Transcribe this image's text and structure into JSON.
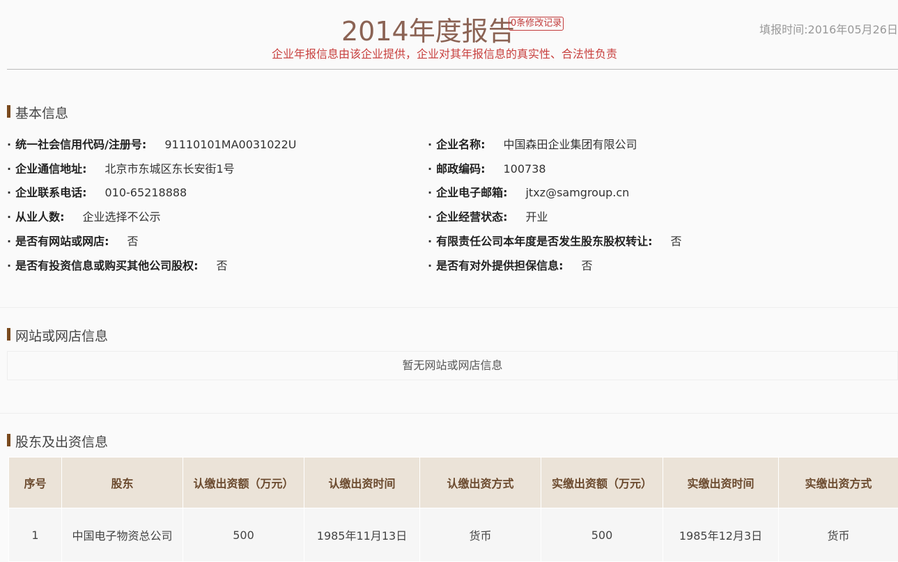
{
  "header": {
    "title": "2014年度报告",
    "modify_badge": "0条修改记录",
    "subtitle": "企业年报信息由该企业提供，企业对其年报信息的真实性、合法性负责",
    "fill_time": "填报时间:2016年05月26日"
  },
  "basic": {
    "title": "基本信息",
    "left": [
      {
        "label": "统一社会信用代码/注册号:",
        "value": "91110101MA0031022U"
      },
      {
        "label": "企业通信地址:",
        "value": "北京市东城区东长安街1号"
      },
      {
        "label": "企业联系电话:",
        "value": "010-65218888"
      },
      {
        "label": "从业人数:",
        "value": "企业选择不公示"
      },
      {
        "label": "是否有网站或网店:",
        "value": "否"
      },
      {
        "label": "是否有投资信息或购买其他公司股权:",
        "value": "否"
      }
    ],
    "right": [
      {
        "label": "企业名称:",
        "value": "中国森田企业集团有限公司"
      },
      {
        "label": "邮政编码:",
        "value": "100738"
      },
      {
        "label": "企业电子邮箱:",
        "value": "jtxz@samgroup.cn"
      },
      {
        "label": "企业经营状态:",
        "value": "开业"
      },
      {
        "label": "有限责任公司本年度是否发生股东股权转让:",
        "value": "否"
      },
      {
        "label": "是否有对外提供担保信息:",
        "value": "否"
      }
    ]
  },
  "website": {
    "title": "网站或网店信息",
    "empty_text": "暂无网站或网店信息"
  },
  "shareholders": {
    "title": "股东及出资信息",
    "columns": [
      "序号",
      "股东",
      "认缴出资额（万元）",
      "认缴出资时间",
      "认缴出资方式",
      "实缴出资额（万元）",
      "实缴出资时间",
      "实缴出资方式"
    ],
    "rows": [
      [
        "1",
        "中国电子物资总公司",
        "500",
        "1985年11月13日",
        "货币",
        "500",
        "1985年12月3日",
        "货币"
      ]
    ]
  },
  "colors": {
    "title": "#8b6354",
    "subtitle": "#c8403e",
    "section_marker": "#7a4a1e",
    "table_header_bg": "#ebe3d8"
  }
}
